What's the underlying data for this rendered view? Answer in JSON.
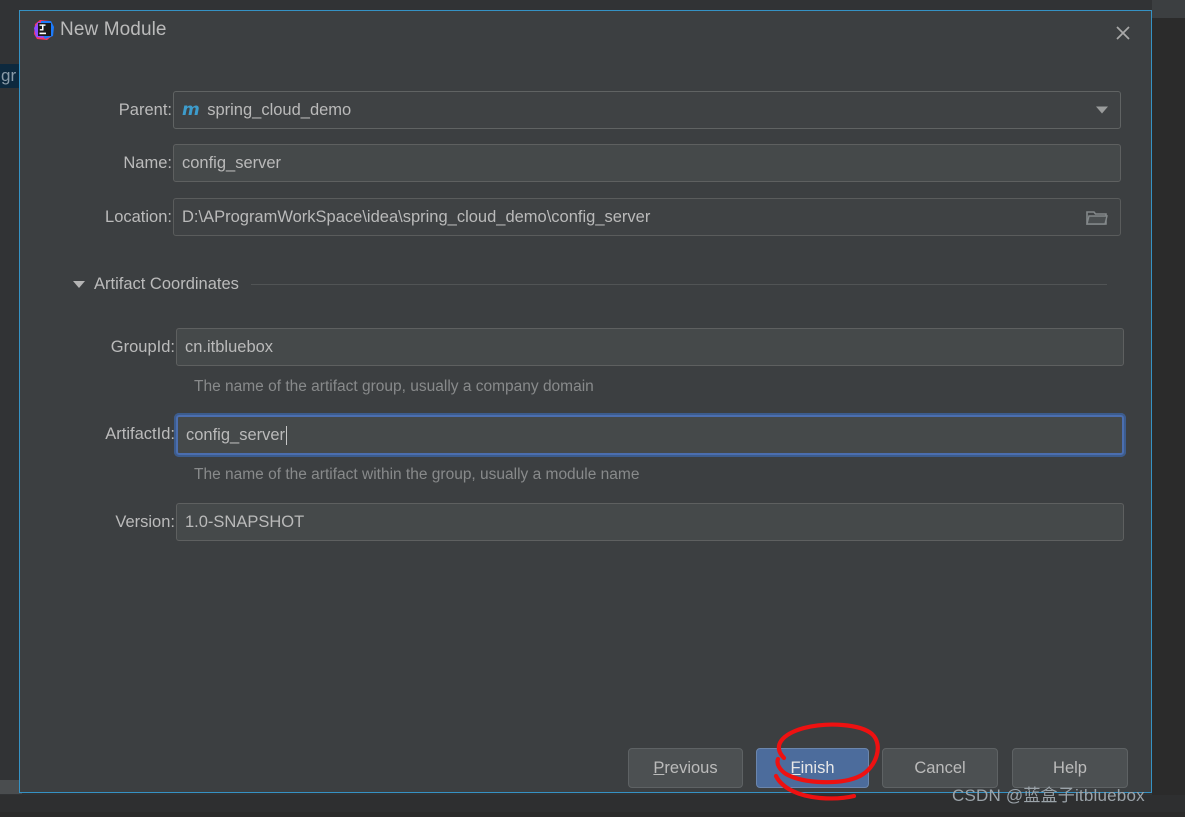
{
  "window": {
    "title": "New Module",
    "app_icon": "intellij-idea-icon",
    "close_icon": "close-icon",
    "border_color": "#3592c4",
    "background_color": "#3c3f41"
  },
  "background": {
    "occluded_tree_item_text": "gr",
    "selection_color": "#0d293e"
  },
  "form": {
    "parent": {
      "label": "Parent:",
      "value": "spring_cloud_demo",
      "icon": "maven-module-icon",
      "dropdown_icon": "chevron-down-icon"
    },
    "name": {
      "label": "Name:",
      "value": "config_server"
    },
    "location": {
      "label": "Location:",
      "value": "D:\\AProgramWorkSpace\\idea\\spring_cloud_demo\\config_server",
      "browse_icon": "folder-open-icon"
    }
  },
  "artifact_coordinates": {
    "section_title": "Artifact Coordinates",
    "collapse_icon": "triangle-down-icon",
    "group_id": {
      "label": "GroupId:",
      "value": "cn.itbluebox",
      "hint": "The name of the artifact group, usually a company domain"
    },
    "artifact_id": {
      "label": "ArtifactId:",
      "value": "config_server",
      "hint": "The name of the artifact within the group, usually a module name",
      "focused": true,
      "focus_color": "#4b6eaf"
    },
    "version": {
      "label": "Version:",
      "value": "1.0-SNAPSHOT"
    }
  },
  "buttons": {
    "previous": {
      "label": "Previous",
      "mnemonic": "P",
      "default": false
    },
    "finish": {
      "label": "Finish",
      "mnemonic": "F",
      "default": true,
      "color": "#4c6c9c"
    },
    "cancel": {
      "label": "Cancel",
      "mnemonic": "",
      "default": false
    },
    "help": {
      "label": "Help",
      "mnemonic": "",
      "default": false
    }
  },
  "annotation": {
    "shape": "red-ellipse-highlight",
    "target": "Finish",
    "color": "#ee1111"
  },
  "watermark": {
    "text": "CSDN @蓝盒子itbluebox"
  }
}
